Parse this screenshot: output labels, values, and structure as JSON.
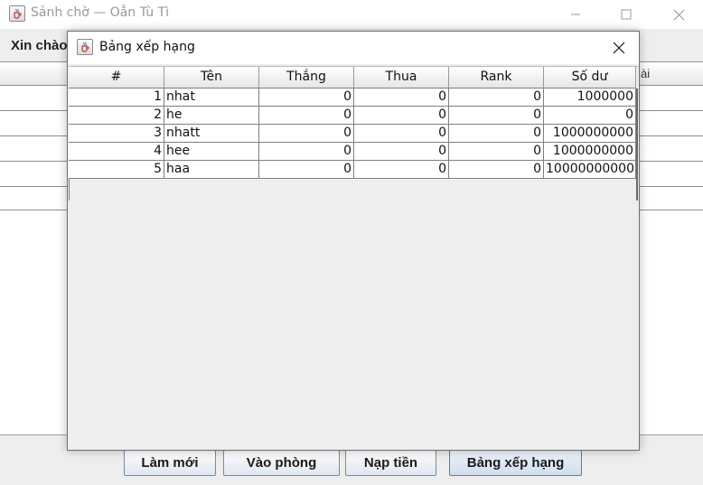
{
  "main_window": {
    "title": "Sảnh chờ — Oẳn Tù Tì",
    "welcome_text": "Xin chào",
    "table_header_fragment": "ài"
  },
  "buttons": {
    "refresh": "Làm mới",
    "join_room": "Vào phòng",
    "deposit": "Nạp tiền",
    "leaderboard": "Bảng xếp hạng"
  },
  "dialog": {
    "title": "Bảng xếp hạng",
    "columns": [
      "#",
      "Tên",
      "Thắng",
      "Thua",
      "Rank",
      "Số dư"
    ],
    "rows": [
      [
        "1",
        "nhat",
        "0",
        "0",
        "0",
        "1000000"
      ],
      [
        "2",
        "he",
        "0",
        "0",
        "0",
        "0"
      ],
      [
        "3",
        "nhatt",
        "0",
        "0",
        "0",
        "1000000000"
      ],
      [
        "4",
        "hee",
        "0",
        "0",
        "0",
        "1000000000"
      ],
      [
        "5",
        "haa",
        "0",
        "0",
        "0",
        "10000000000"
      ]
    ]
  },
  "icons": {
    "app_icon": "java-coffee-cup-icon",
    "minimize": "minimize-icon",
    "maximize": "maximize-icon",
    "close": "close-icon"
  }
}
